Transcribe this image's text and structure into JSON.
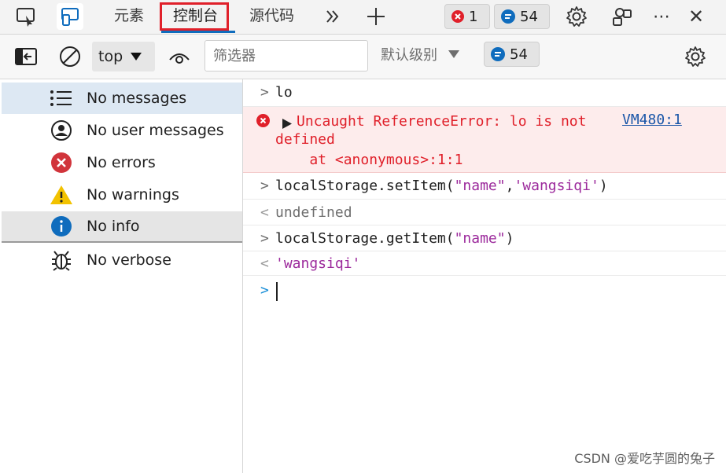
{
  "tabbar": {
    "tabs": [
      "元素",
      "控制台",
      "源代码"
    ],
    "active_tab": "控制台",
    "error_count": "1",
    "message_count": "54",
    "more_label": "⋯",
    "close_label": "✕"
  },
  "toolbar": {
    "context": "top",
    "filter_placeholder": "筛选器",
    "level_label": "默认级别",
    "message_count": "54"
  },
  "sidebar": {
    "items": [
      {
        "label": "No messages",
        "icon": "list-icon"
      },
      {
        "label": "No user messages",
        "icon": "user-icon"
      },
      {
        "label": "No errors",
        "icon": "error-icon"
      },
      {
        "label": "No warnings",
        "icon": "warning-icon"
      },
      {
        "label": "No info",
        "icon": "info-icon"
      },
      {
        "label": "No verbose",
        "icon": "bug-icon"
      }
    ]
  },
  "console": {
    "entries": [
      {
        "type": "input",
        "text": "lo"
      },
      {
        "type": "error",
        "line1": "Uncaught ReferenceError: lo is not",
        "line2": "defined",
        "line3": "    at <anonymous>:1:1",
        "source": "VM480:1"
      },
      {
        "type": "input",
        "prefix": "localStorage.setItem(",
        "arg1": "\"name\"",
        "sep": ",",
        "arg2": "'wangsiqi'",
        "suffix": ")"
      },
      {
        "type": "output",
        "text": "undefined"
      },
      {
        "type": "input",
        "prefix": "localStorage.getItem(",
        "arg1": "\"name\"",
        "suffix": ")"
      },
      {
        "type": "output",
        "text": "'wangsiqi'"
      }
    ]
  },
  "watermark": "CSDN @爱吃芋圆的兔子",
  "colors": {
    "accent": "#0f6cbd",
    "error": "#e0202a",
    "string": "#9c2a9c",
    "info": "#0f6cbd",
    "warning": "#f2c200"
  }
}
